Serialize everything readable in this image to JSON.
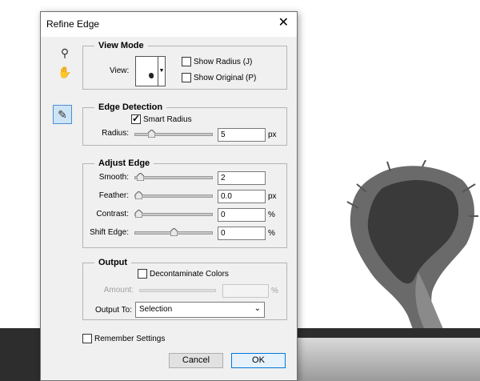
{
  "dialog": {
    "title": "Refine Edge",
    "close_glyph": "✕",
    "tools": {
      "zoom_icon": "⚲",
      "hand_icon": "✋",
      "brush_icon": "✎"
    }
  },
  "view_mode": {
    "legend": "View Mode",
    "view_label": "View:",
    "show_radius_label": "Show Radius (J)",
    "show_radius_checked": false,
    "show_original_label": "Show Original (P)",
    "show_original_checked": false
  },
  "edge_detection": {
    "legend": "Edge Detection",
    "smart_radius_label": "Smart Radius",
    "smart_radius_checked": true,
    "radius_label": "Radius:",
    "radius_value": "5",
    "radius_unit": "px",
    "radius_slider_fraction": 0.18
  },
  "adjust_edge": {
    "legend": "Adjust Edge",
    "rows": [
      {
        "label": "Smooth:",
        "value": "2",
        "unit": "",
        "slider_fraction": 0.02
      },
      {
        "label": "Feather:",
        "value": "0.0",
        "unit": "px",
        "slider_fraction": 0.0
      },
      {
        "label": "Contrast:",
        "value": "0",
        "unit": "%",
        "slider_fraction": 0.0
      },
      {
        "label": "Shift Edge:",
        "value": "0",
        "unit": "%",
        "slider_fraction": 0.5
      }
    ]
  },
  "output": {
    "legend": "Output",
    "decontaminate_label": "Decontaminate Colors",
    "decontaminate_checked": false,
    "amount_label": "Amount:",
    "amount_value": "",
    "amount_unit": "%",
    "output_to_label": "Output To:",
    "output_to_value": "Selection",
    "dropdown_arrow": "⌄"
  },
  "remember_label": "Remember Settings",
  "remember_checked": false,
  "buttons": {
    "cancel": "Cancel",
    "ok": "OK"
  },
  "colors": {
    "accent": "#0078d7",
    "tool_active_bg": "#cde4f7",
    "dialog_bg": "#f0f0f0",
    "band": "#2d2d2d"
  }
}
